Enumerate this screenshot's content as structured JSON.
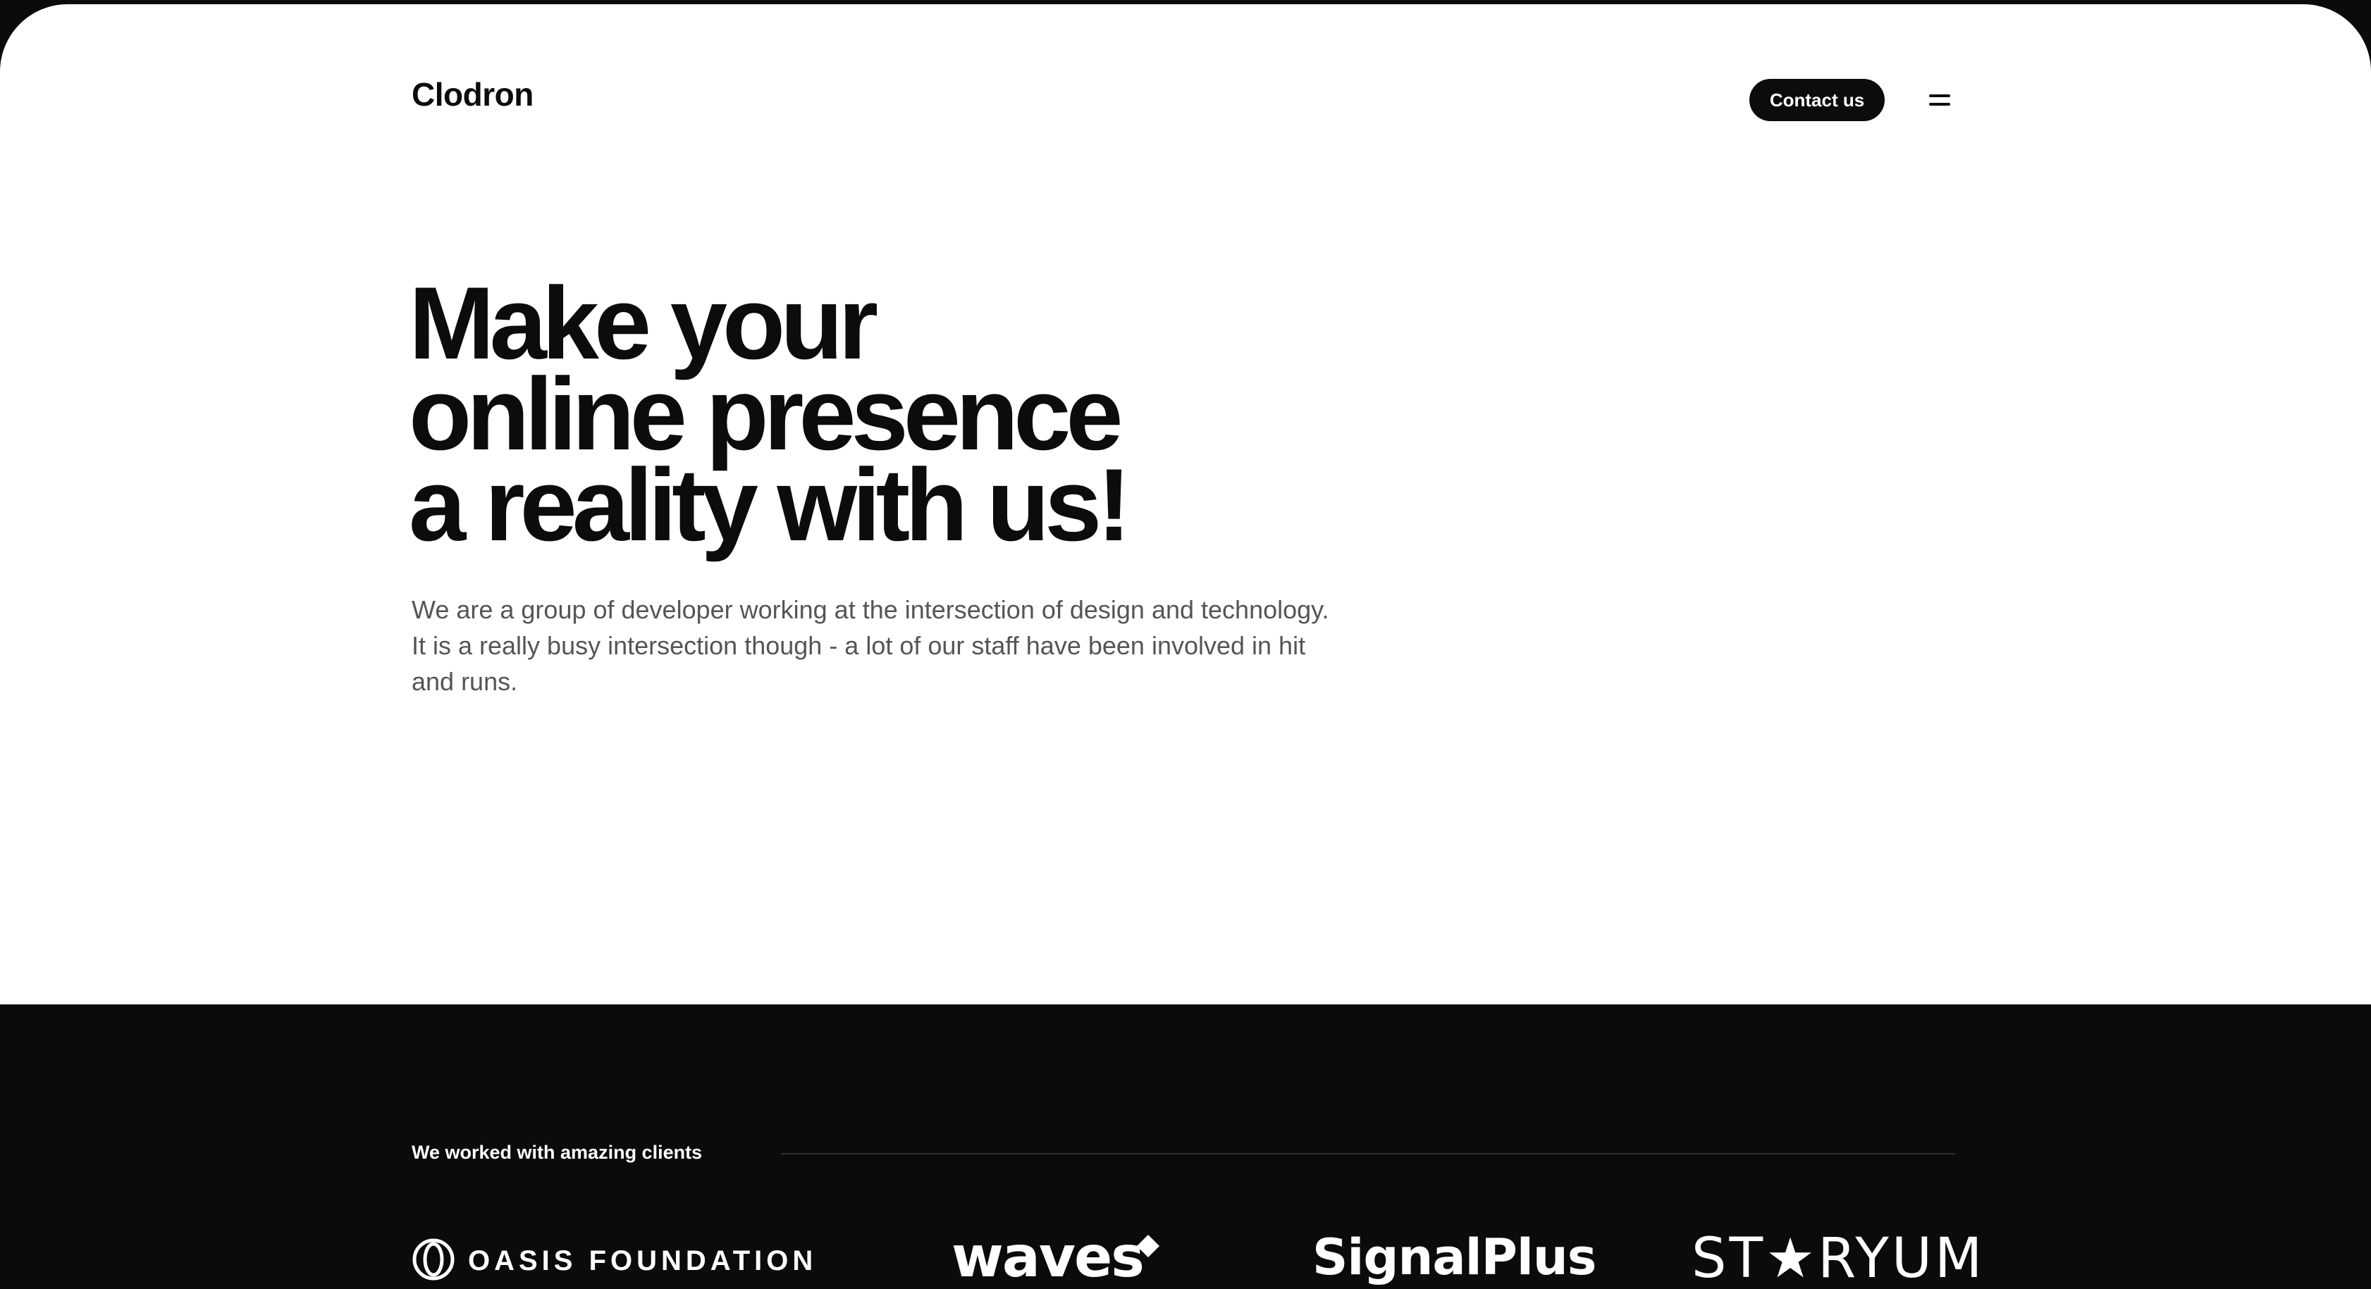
{
  "header": {
    "logo": "Clodron",
    "contact_label": "Contact us",
    "menu_icon": "menu-icon"
  },
  "hero": {
    "headline_lines": [
      "Make your",
      "online presence",
      "a reality with us!"
    ],
    "lead_lines": [
      "We are a group of developer working at the intersection of design and technology.",
      "It is a really busy intersection though - a lot of our staff have been involved in hit",
      "and runs."
    ]
  },
  "clients": {
    "label": "We worked with amazing clients",
    "logos": [
      {
        "name": "OASIS FOUNDATION",
        "icon": "oasis-ring-icon"
      },
      {
        "name": "waves",
        "icon": "diamond-icon"
      },
      {
        "name": "SignalPlus"
      },
      {
        "name": "ST★RYUM"
      }
    ]
  },
  "colors": {
    "page_bg": "#ffffff",
    "dark_section": "#0b0b0b",
    "text_primary": "#0c0c0c",
    "text_secondary": "#555555"
  }
}
